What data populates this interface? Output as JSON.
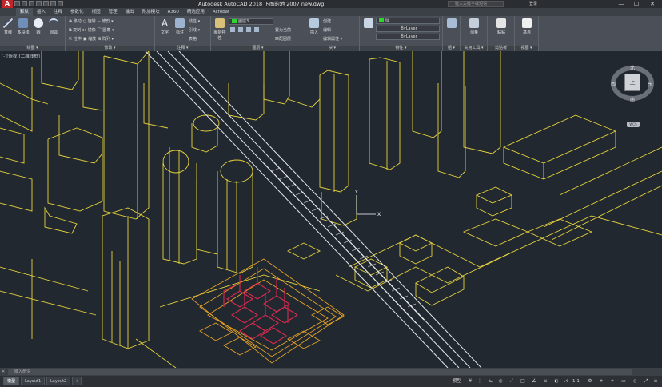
{
  "app": {
    "logo": "A",
    "title": "Autodesk AutoCAD 2018    下面的地 2007 new.dwg",
    "search_placeholder": "键入关键字或短语",
    "signin": "登录",
    "window_controls": [
      "—",
      "☐",
      "✕"
    ]
  },
  "tabs": [
    "默认",
    "插入",
    "注释",
    "参数化",
    "视图",
    "管理",
    "输出",
    "附加模块",
    "A360",
    "精选应用",
    "Acrobat"
  ],
  "ribbon": {
    "draw": {
      "label": "绘图 ▾",
      "tools": [
        "直线",
        "多段线",
        "圆",
        "圆弧"
      ]
    },
    "modify": {
      "label": "修改 ▾",
      "rows": [
        [
          "✥ 移动",
          "○ 旋转",
          "⌐ 修剪 ▾"
        ],
        [
          "⧉ 复制",
          "⋈ 镜像",
          "⌒ 圆角 ▾"
        ],
        [
          "⇱ 拉伸",
          "▣ 缩放",
          "⊞ 阵列 ▾"
        ]
      ]
    },
    "annotation": {
      "label": "注释 ▾",
      "big": [
        "文字",
        "标注"
      ],
      "rows": [
        "线性 ▾",
        "引线 ▾",
        "表格"
      ]
    },
    "layers": {
      "label": "图层 ▾",
      "big": "图层特性",
      "layer_combo": "图层3",
      "rows": [
        "置为当前",
        "匹配图层"
      ]
    },
    "block": {
      "label": "块 ▾",
      "big": "插入",
      "rows": [
        "创建",
        "编辑",
        "编辑属性 ▾"
      ]
    },
    "properties": {
      "label": "特性 ▾",
      "color_value": "绿",
      "linetype_value": "ByLayer",
      "lineweight_value": "ByLayer",
      "big": "特性匹配"
    },
    "groups": {
      "label": "组 ▾"
    },
    "utilities": {
      "label": "实用工具 ▾",
      "big": "测量"
    },
    "clipboard": {
      "label": "剪贴板",
      "big": "粘贴"
    },
    "view": {
      "label": "视图 ▾",
      "big": "基点"
    }
  },
  "viewport": {
    "label": "[-][俯视][二维线框]",
    "viewcube": {
      "north": "北",
      "south": "南",
      "east": "东",
      "west": "西",
      "face": "上"
    },
    "wcs": "WCS",
    "ucs_x": "X",
    "ucs_y": "Y"
  },
  "command": {
    "placeholder": "键入命令"
  },
  "status": {
    "layout_tabs": [
      "模型",
      "Layout1",
      "Layout2"
    ],
    "add_tab": "+",
    "model_text": "模型",
    "scale": "1:1"
  },
  "colors": {
    "background": "#212830",
    "building_lines": "#e6d23c",
    "rail_lines": "#e8e8e8",
    "detail_red": "#e0284e",
    "detail_orange": "#e8a324"
  }
}
